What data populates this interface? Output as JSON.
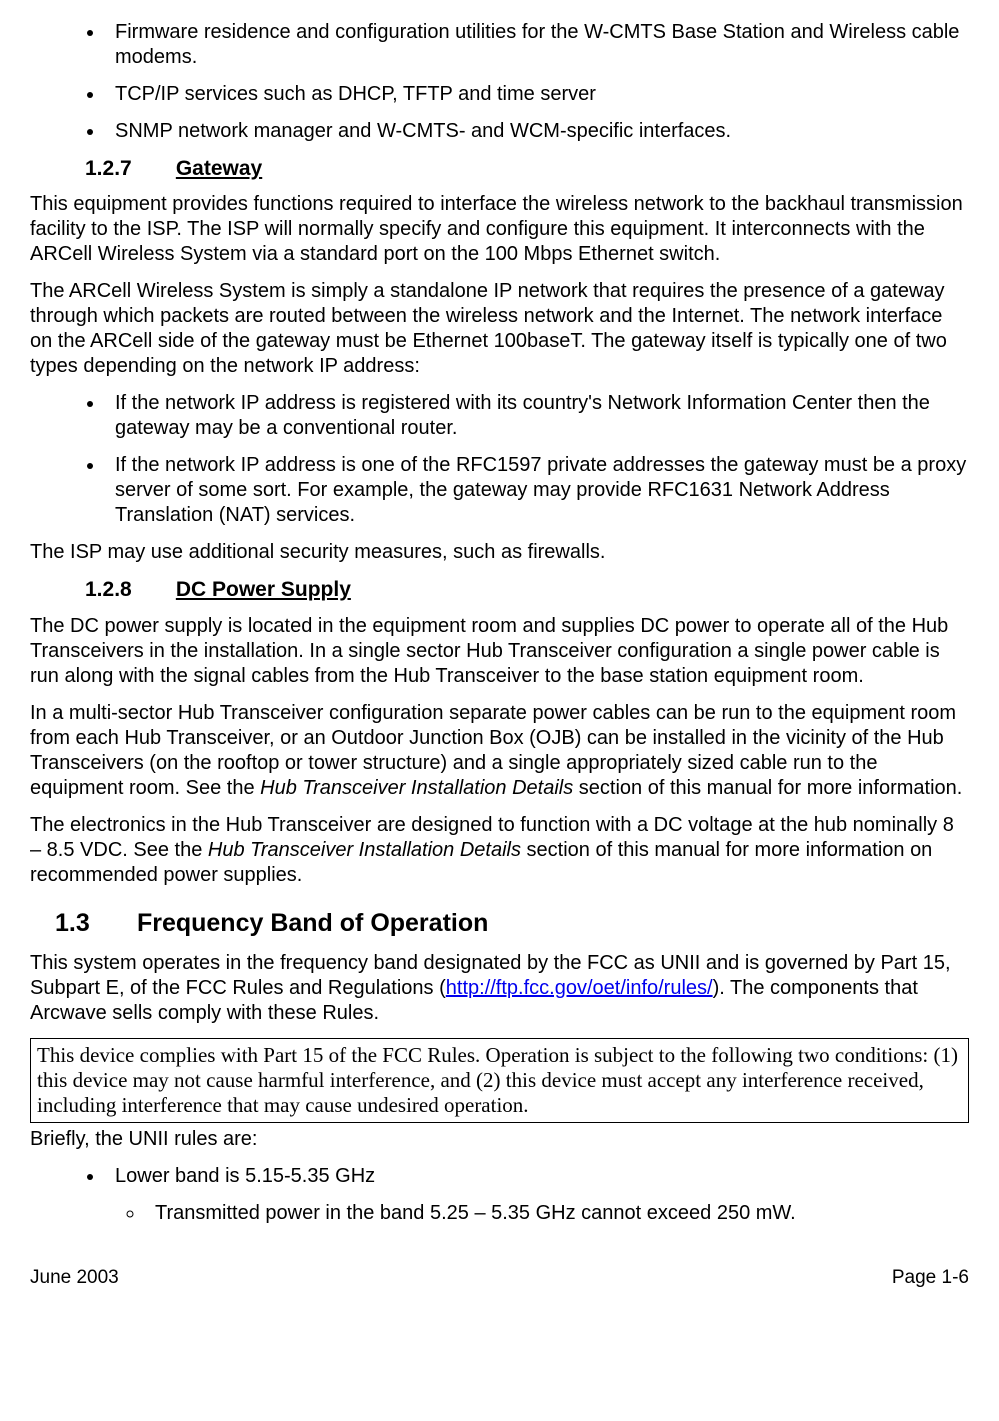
{
  "top_bullets": [
    "Firmware residence and configuration utilities for the W-CMTS Base Station and Wireless cable modems.",
    "TCP/IP services such as DHCP, TFTP and time server",
    "SNMP network manager and W-CMTS- and WCM-specific interfaces."
  ],
  "s127": {
    "num": "1.2.7",
    "title": "Gateway",
    "p1": "This equipment provides functions required to interface the wireless network to the backhaul transmission facility to the ISP.  The ISP will normally specify and configure this equipment.  It interconnects with the ARCell Wireless System via a standard port on the 100 Mbps Ethernet switch.",
    "p2": "The ARCell Wireless System is simply a standalone IP network that requires the presence of a gateway through which packets are routed between the wireless network and the Internet. The network interface on the ARCell side of the gateway must be Ethernet 100baseT.  The gateway itself is typically one of two types depending on the network IP address:",
    "bullets": [
      "If the network IP address is registered with its country's Network Information Center then the gateway may be a conventional router.",
      "If the network IP address is one of the RFC1597 private addresses the gateway must be a proxy server of some sort. For example, the gateway may provide RFC1631 Network Address Translation (NAT) services."
    ],
    "p3": "The ISP may use additional security measures, such as firewalls."
  },
  "s128": {
    "num": "1.2.8",
    "title": "DC Power Supply",
    "p1": "The DC power supply is located in the equipment room and supplies DC power to operate all of the Hub Transceivers in the installation.  In a single sector Hub Transceiver configuration a single power cable is run along with the signal cables from the Hub Transceiver to the base station equipment room.",
    "p2_a": "In a multi-sector Hub Transceiver configuration separate power cables can be run to the equipment room from each Hub Transceiver, or an Outdoor Junction Box (OJB) can be installed in the vicinity of the Hub Transceivers (on the rooftop or tower structure) and a single appropriately sized cable run to the equipment room.  See the ",
    "p2_i": "Hub Transceiver Installation Details",
    "p2_b": " section of this manual for more information.",
    "p3_a": "The electronics in the Hub Transceiver are designed to function with a DC voltage at the hub nominally 8 – 8.5 VDC.  See the ",
    "p3_i": "Hub Transceiver Installation Details",
    "p3_b": " section of this manual for more information on recommended power supplies."
  },
  "s13": {
    "num": "1.3",
    "title": "Frequency Band of Operation",
    "p1_a": "This system operates in the frequency band designated by the FCC as UNII and is governed by Part 15, Subpart E, of the FCC Rules and Regulations (",
    "p1_link": "http://ftp.fcc.gov/oet/info/rules/",
    "p1_b": ").  The components that Arcwave sells comply with these Rules.",
    "boxed": "This device complies with Part 15 of the FCC Rules. Operation is subject to the following two conditions: (1) this device may not cause harmful interference, and (2) this device must accept any interference received, including interference that may cause undesired operation.",
    "p2": "Briefly, the UNII rules are:",
    "bullet1": "Lower band is 5.15-5.35 GHz",
    "sub_bullet1": "Transmitted power in the band 5.25 – 5.35 GHz cannot exceed 250 mW."
  },
  "footer": {
    "left": "June 2003",
    "right": "Page 1-6"
  }
}
